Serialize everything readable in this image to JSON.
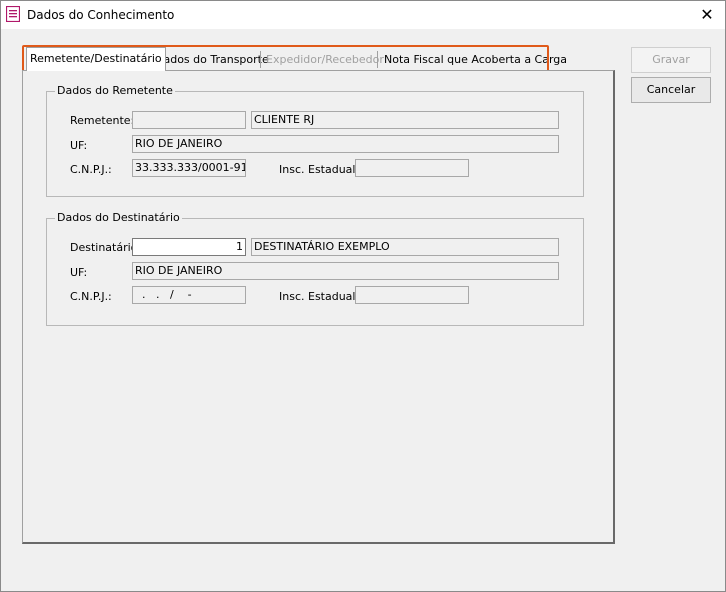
{
  "window": {
    "title": "Dados do Conhecimento",
    "close_glyph": "✕"
  },
  "tabs": [
    {
      "label": "Remetente/Destinatário",
      "active": true,
      "enabled": true
    },
    {
      "label": "Dados do Transporte",
      "active": false,
      "enabled": true
    },
    {
      "label": "Expedidor/Recebedor",
      "active": false,
      "enabled": false
    },
    {
      "label": "Nota Fiscal que Acoberta a Carga",
      "active": false,
      "enabled": true
    }
  ],
  "buttons": {
    "save": "Gravar",
    "cancel": "Cancelar"
  },
  "remetente": {
    "group_title": "Dados do Remetente",
    "label_remetente": "Remetente:",
    "code": "",
    "name": "CLIENTE RJ",
    "label_uf": "UF:",
    "uf": "RIO DE JANEIRO",
    "label_cnpj": "C.N.P.J.:",
    "cnpj": "33.333.333/0001-91",
    "label_ie": "Insc. Estadual:",
    "ie": ""
  },
  "destinatario": {
    "group_title": "Dados do Destinatário",
    "label_destinatario": "Destinatário:",
    "code": "1",
    "name": "DESTINATÁRIO EXEMPLO",
    "label_uf": "UF:",
    "uf": "RIO DE JANEIRO",
    "label_cnpj": "C.N.P.J.:",
    "cnpj": "  .   .   /    -",
    "label_ie": "Insc. Estadual:",
    "ie": ""
  },
  "colors": {
    "highlight": "#e05a1a",
    "icon": "#b0186a"
  }
}
